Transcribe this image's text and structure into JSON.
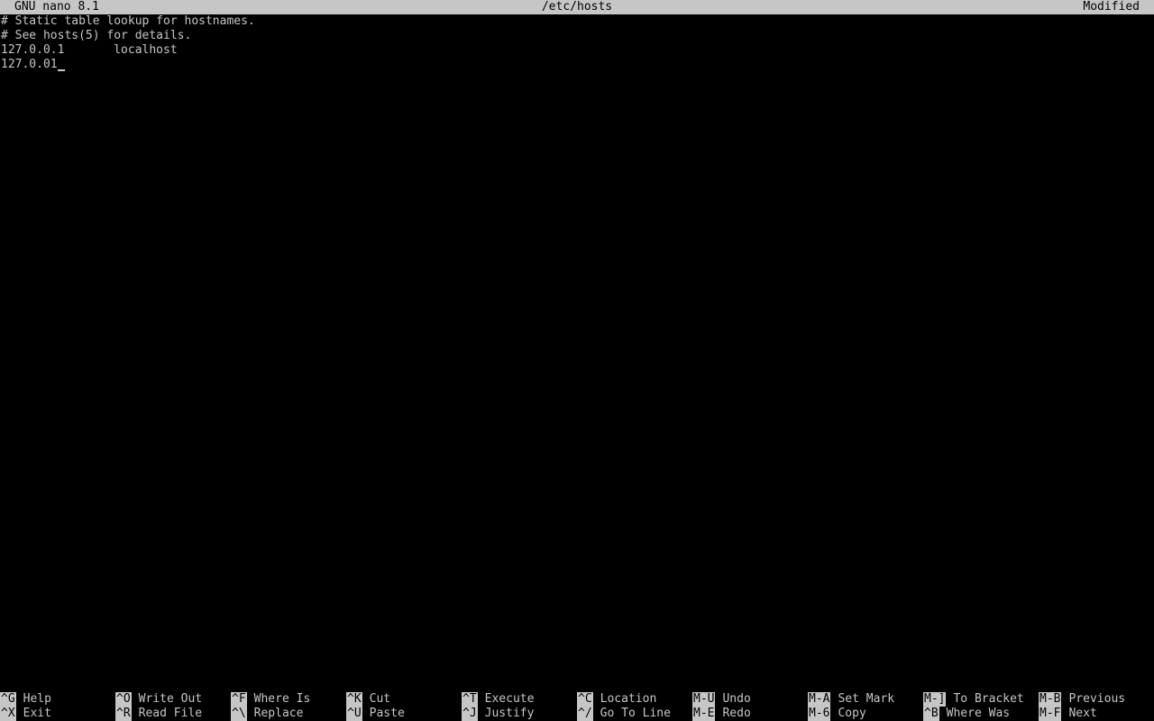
{
  "titlebar": {
    "version": "GNU nano 8.1",
    "filename": "/etc/hosts",
    "state": "Modified"
  },
  "editor": {
    "lines": [
      "# Static table lookup for hostnames.",
      "# See hosts(5) for details.",
      "127.0.0.1       localhost",
      "127.0.01"
    ]
  },
  "shortcuts": {
    "row1": [
      {
        "key": "^G",
        "label": "Help"
      },
      {
        "key": "^O",
        "label": "Write Out"
      },
      {
        "key": "^F",
        "label": "Where Is"
      },
      {
        "key": "^K",
        "label": "Cut"
      },
      {
        "key": "^T",
        "label": "Execute"
      },
      {
        "key": "^C",
        "label": "Location"
      },
      {
        "key": "M-U",
        "label": "Undo"
      },
      {
        "key": "M-A",
        "label": "Set Mark"
      },
      {
        "key": "M-]",
        "label": "To Bracket"
      },
      {
        "key": "M-B",
        "label": "Previous"
      }
    ],
    "row2": [
      {
        "key": "^X",
        "label": "Exit"
      },
      {
        "key": "^R",
        "label": "Read File"
      },
      {
        "key": "^\\",
        "label": "Replace"
      },
      {
        "key": "^U",
        "label": "Paste"
      },
      {
        "key": "^J",
        "label": "Justify"
      },
      {
        "key": "^/",
        "label": "Go To Line"
      },
      {
        "key": "M-E",
        "label": "Redo"
      },
      {
        "key": "M-6",
        "label": "Copy"
      },
      {
        "key": "^B",
        "label": "Where Was"
      },
      {
        "key": "M-F",
        "label": "Next"
      }
    ]
  },
  "colors": {
    "background": "#000000",
    "foreground": "#c6c6c6"
  }
}
